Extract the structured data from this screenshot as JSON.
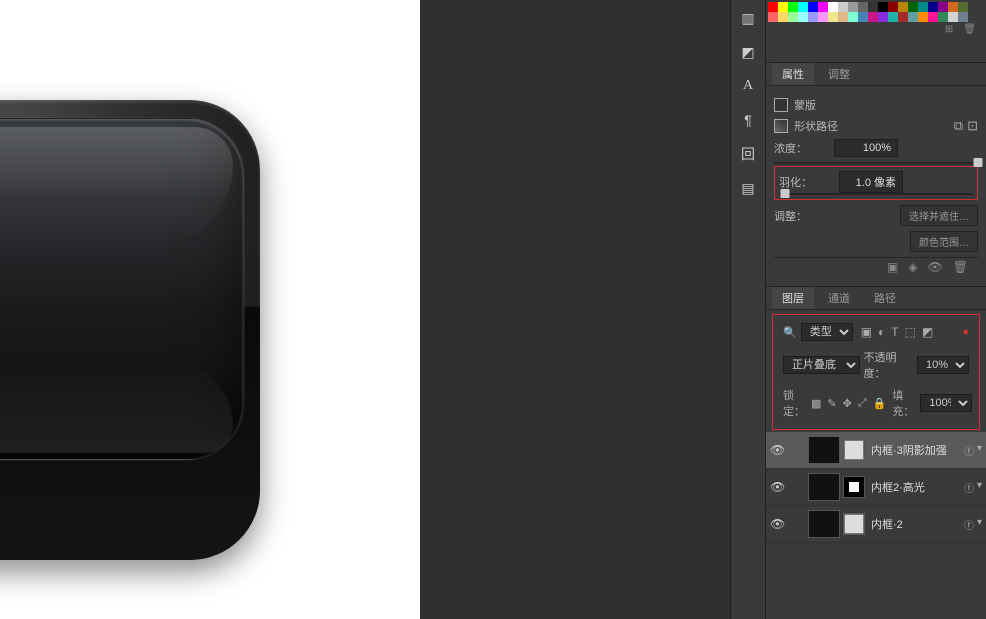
{
  "properties": {
    "tab_properties": "属性",
    "tab_adjustments": "调整",
    "mask_title": "蒙版",
    "shape_path_title": "形状路径",
    "density_label": "浓度：",
    "density_value": "100%",
    "density_pct": 100,
    "feather_label": "羽化：",
    "feather_value": "1.0 像素",
    "feather_pct": 3,
    "refine_label": "调整：",
    "select_and_mask": "选择并遮住…",
    "color_range": "颜色范围…"
  },
  "layers": {
    "tab_layers": "图层",
    "tab_channels": "通道",
    "tab_paths": "路径",
    "filter_kind_label": "类型",
    "blend_mode": "正片叠底",
    "opacity_label": "不透明度：",
    "opacity_value": "10%",
    "lock_label": "锁定：",
    "fill_label": "填充：",
    "fill_value": "100%",
    "items": [
      {
        "name": "内框·3阴影加强",
        "selected": true,
        "has_mask": false
      },
      {
        "name": "内框2·高光",
        "selected": false,
        "has_mask": true
      },
      {
        "name": "内框·2",
        "selected": false,
        "has_mask": false
      }
    ]
  },
  "swatches": {
    "colors": [
      "#ff0000",
      "#ffff00",
      "#00ff00",
      "#00ffff",
      "#0000ff",
      "#ff00ff",
      "#ffffff",
      "#cccccc",
      "#999999",
      "#666666",
      "#333333",
      "#000000",
      "#8b0000",
      "#b8860b",
      "#006400",
      "#008b8b",
      "#00008b",
      "#8b008b",
      "#d2691e",
      "#556b2f",
      "#ff6666",
      "#ffd966",
      "#99ff99",
      "#99ffff",
      "#9999ff",
      "#ff99ff",
      "#f0e68c",
      "#deb887",
      "#7fffd4",
      "#4682b4",
      "#c71585",
      "#8a2be2",
      "#20b2aa",
      "#a52a2a",
      "#5f9ea0",
      "#ff8c00",
      "#ff1493",
      "#2e8b57",
      "#d3d3d3",
      "#708090"
    ]
  },
  "icons": {
    "search": "🔍",
    "image": "▣",
    "adjust": "◐",
    "type": "T",
    "shape": "⬚",
    "smart": "◩",
    "dot": "●",
    "eye": "👁",
    "link": "⧉",
    "anchor": "⊡"
  },
  "dock": {
    "items": [
      "histogram-icon",
      "nav-icon",
      "type-icon",
      "paragraph-icon",
      "glyph-icon",
      "library-icon"
    ]
  }
}
